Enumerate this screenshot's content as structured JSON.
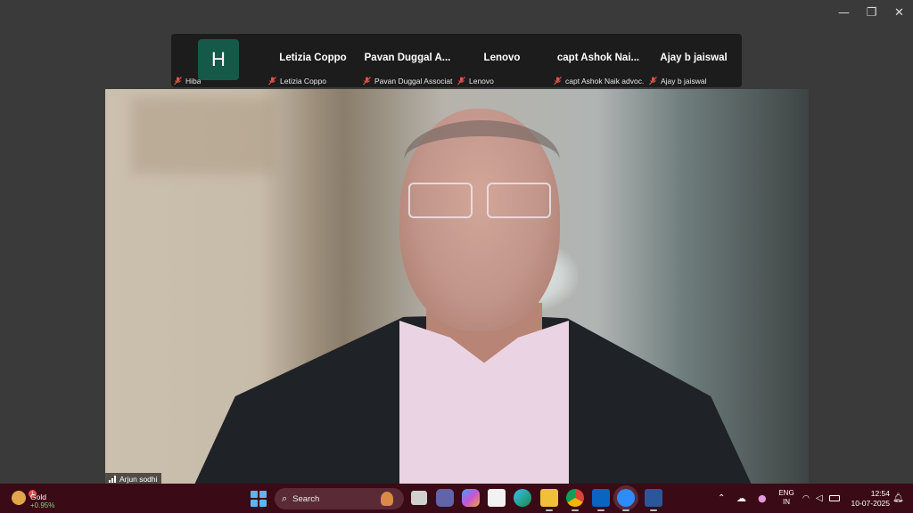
{
  "window_controls": {
    "minimize": "—",
    "restore": "❐",
    "close": "✕"
  },
  "gallery": {
    "tiles": [
      {
        "avatar": "H",
        "label": "Hiba",
        "name": ""
      },
      {
        "name": "Letizia Coppo",
        "label": "Letizia Coppo"
      },
      {
        "name": "Pavan Duggal A...",
        "label": "Pavan Duggal Associat..."
      },
      {
        "name": "Lenovo",
        "label": "Lenovo"
      },
      {
        "name": "capt Ashok Nai...",
        "label": "capt Ashok Naik advoc..."
      },
      {
        "name": "Ajay b jaiswal",
        "label": "Ajay b jaiswal"
      }
    ]
  },
  "active_speaker": {
    "name": "Arjun sodhi"
  },
  "taskbar": {
    "widget": {
      "badge": "1",
      "title": "Gold",
      "change": "+0.95%"
    },
    "search_placeholder": "Search",
    "language": {
      "line1": "ENG",
      "line2": "IN"
    },
    "time": "12:54",
    "date": "10-07-2025"
  },
  "colors": {
    "taskbar": "#3b0a17",
    "avatar_bg": "#155a48",
    "muted_mic": "#e0534a"
  }
}
